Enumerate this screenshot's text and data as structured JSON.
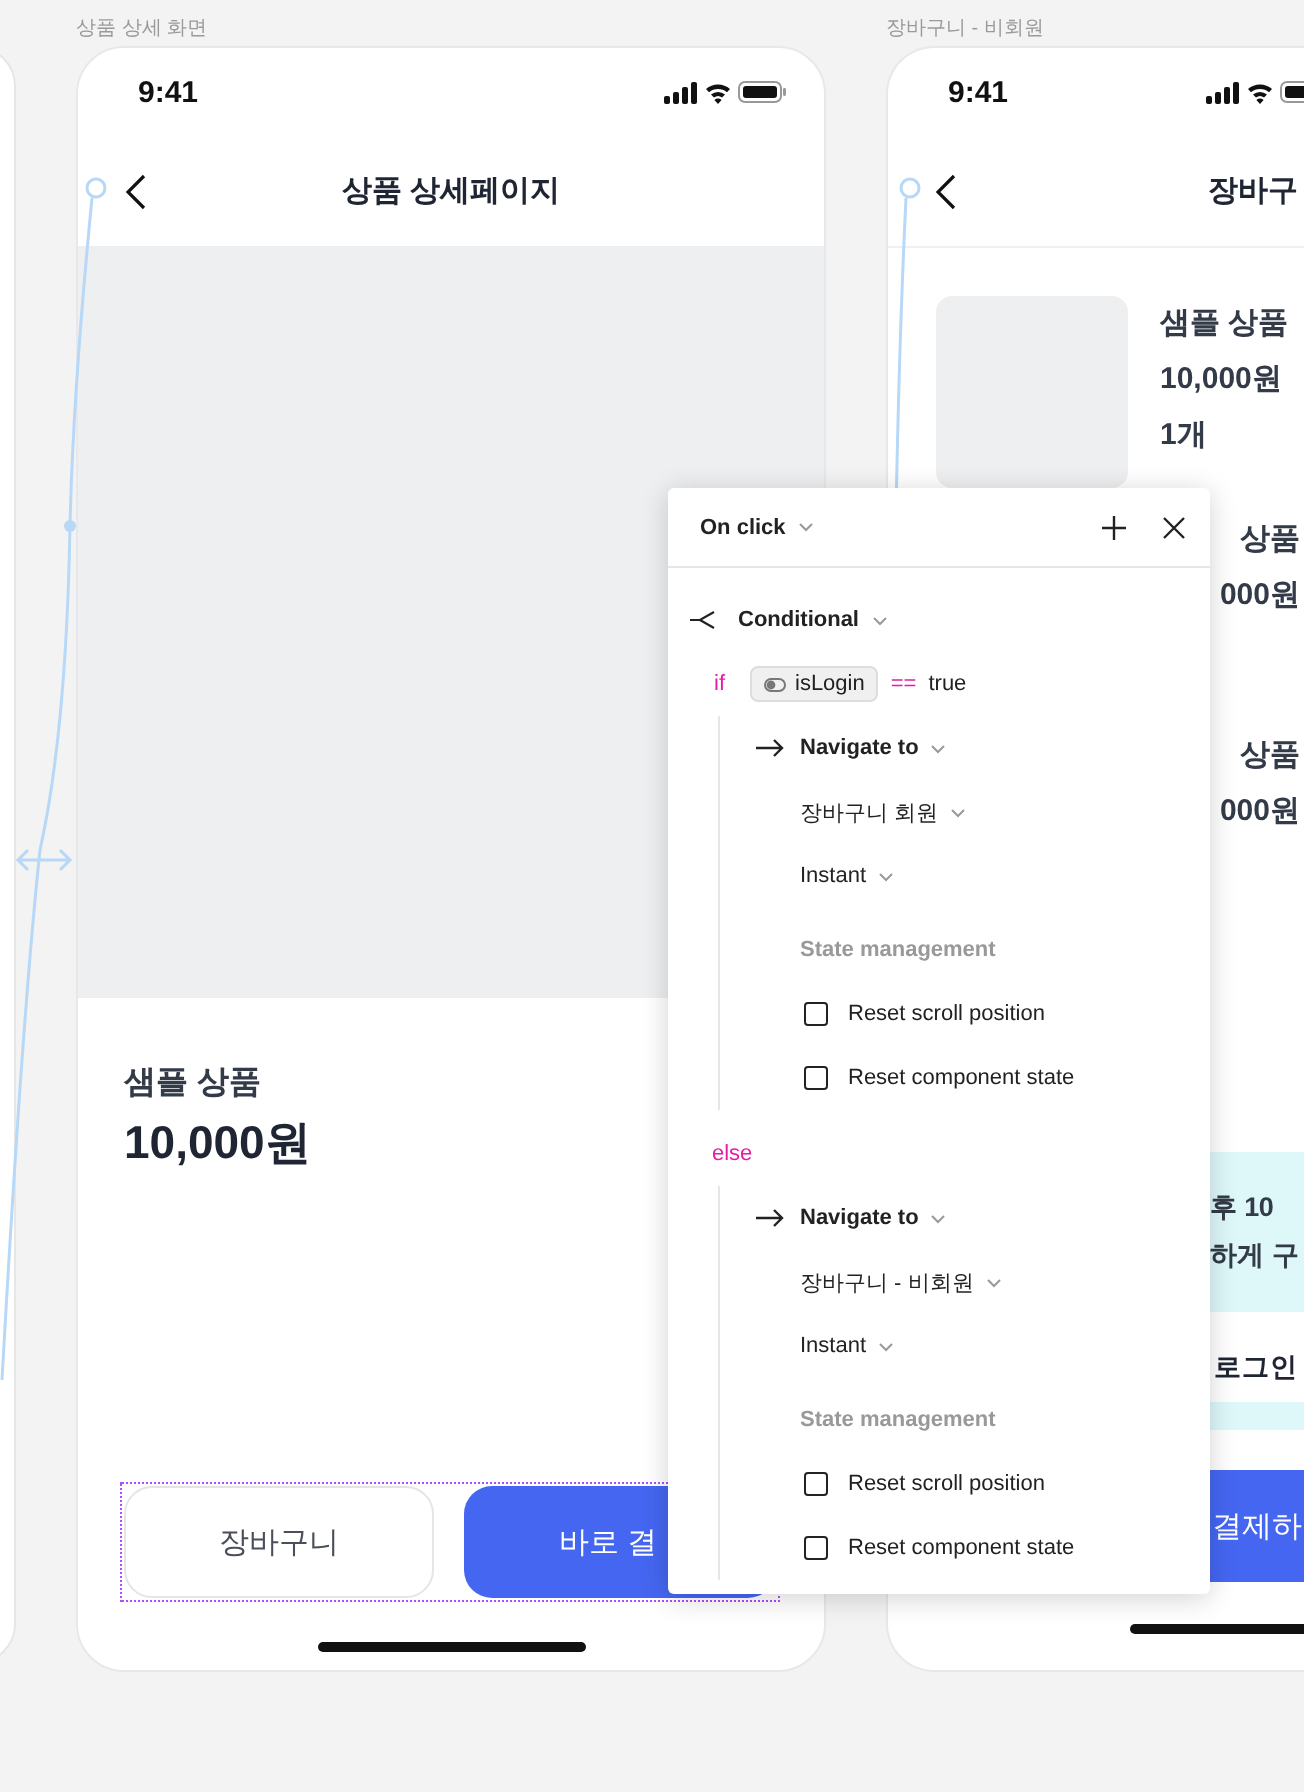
{
  "canvas_frames": [
    {
      "label": "상품 상세 화면"
    },
    {
      "label": "장바구니 - 비회원"
    }
  ],
  "product_screen": {
    "status_time": "9:41",
    "title": "상품 상세페이지",
    "product_name": "샘플 상품",
    "price": "10,000원",
    "buttons": [
      {
        "label": "장바구니",
        "kind": "outline"
      },
      {
        "label": "바로 결",
        "kind": "primary"
      }
    ]
  },
  "cart_screen": {
    "status_time": "9:41",
    "title": "장바구",
    "items": [
      {
        "name": "샘플 상품",
        "price": "10,000원",
        "quantity": "1개"
      },
      {
        "name": "상품",
        "price": "000원"
      },
      {
        "name": "상품",
        "price": "000원"
      }
    ],
    "banner_lines": [
      "후 10",
      "하게 구"
    ],
    "login_link": "로그인",
    "button": "결제하"
  },
  "interaction_panel": {
    "trigger": "On click",
    "action": "Conditional",
    "condition": {
      "keyword": "if",
      "variable": "isLogin",
      "operator": "==",
      "value": "true"
    },
    "if_branch": {
      "action": "Navigate to",
      "destination": "장바구니 회원",
      "transition": "Instant",
      "section_title": "State management",
      "options": [
        {
          "label": "Reset scroll position",
          "checked": false
        },
        {
          "label": "Reset component state",
          "checked": false
        }
      ]
    },
    "else_keyword": "else",
    "else_branch": {
      "action": "Navigate to",
      "destination": "장바구니 - 비회원",
      "transition": "Instant",
      "section_title": "State management",
      "options": [
        {
          "label": "Reset scroll position",
          "checked": false
        },
        {
          "label": "Reset component state",
          "checked": false
        }
      ]
    }
  }
}
